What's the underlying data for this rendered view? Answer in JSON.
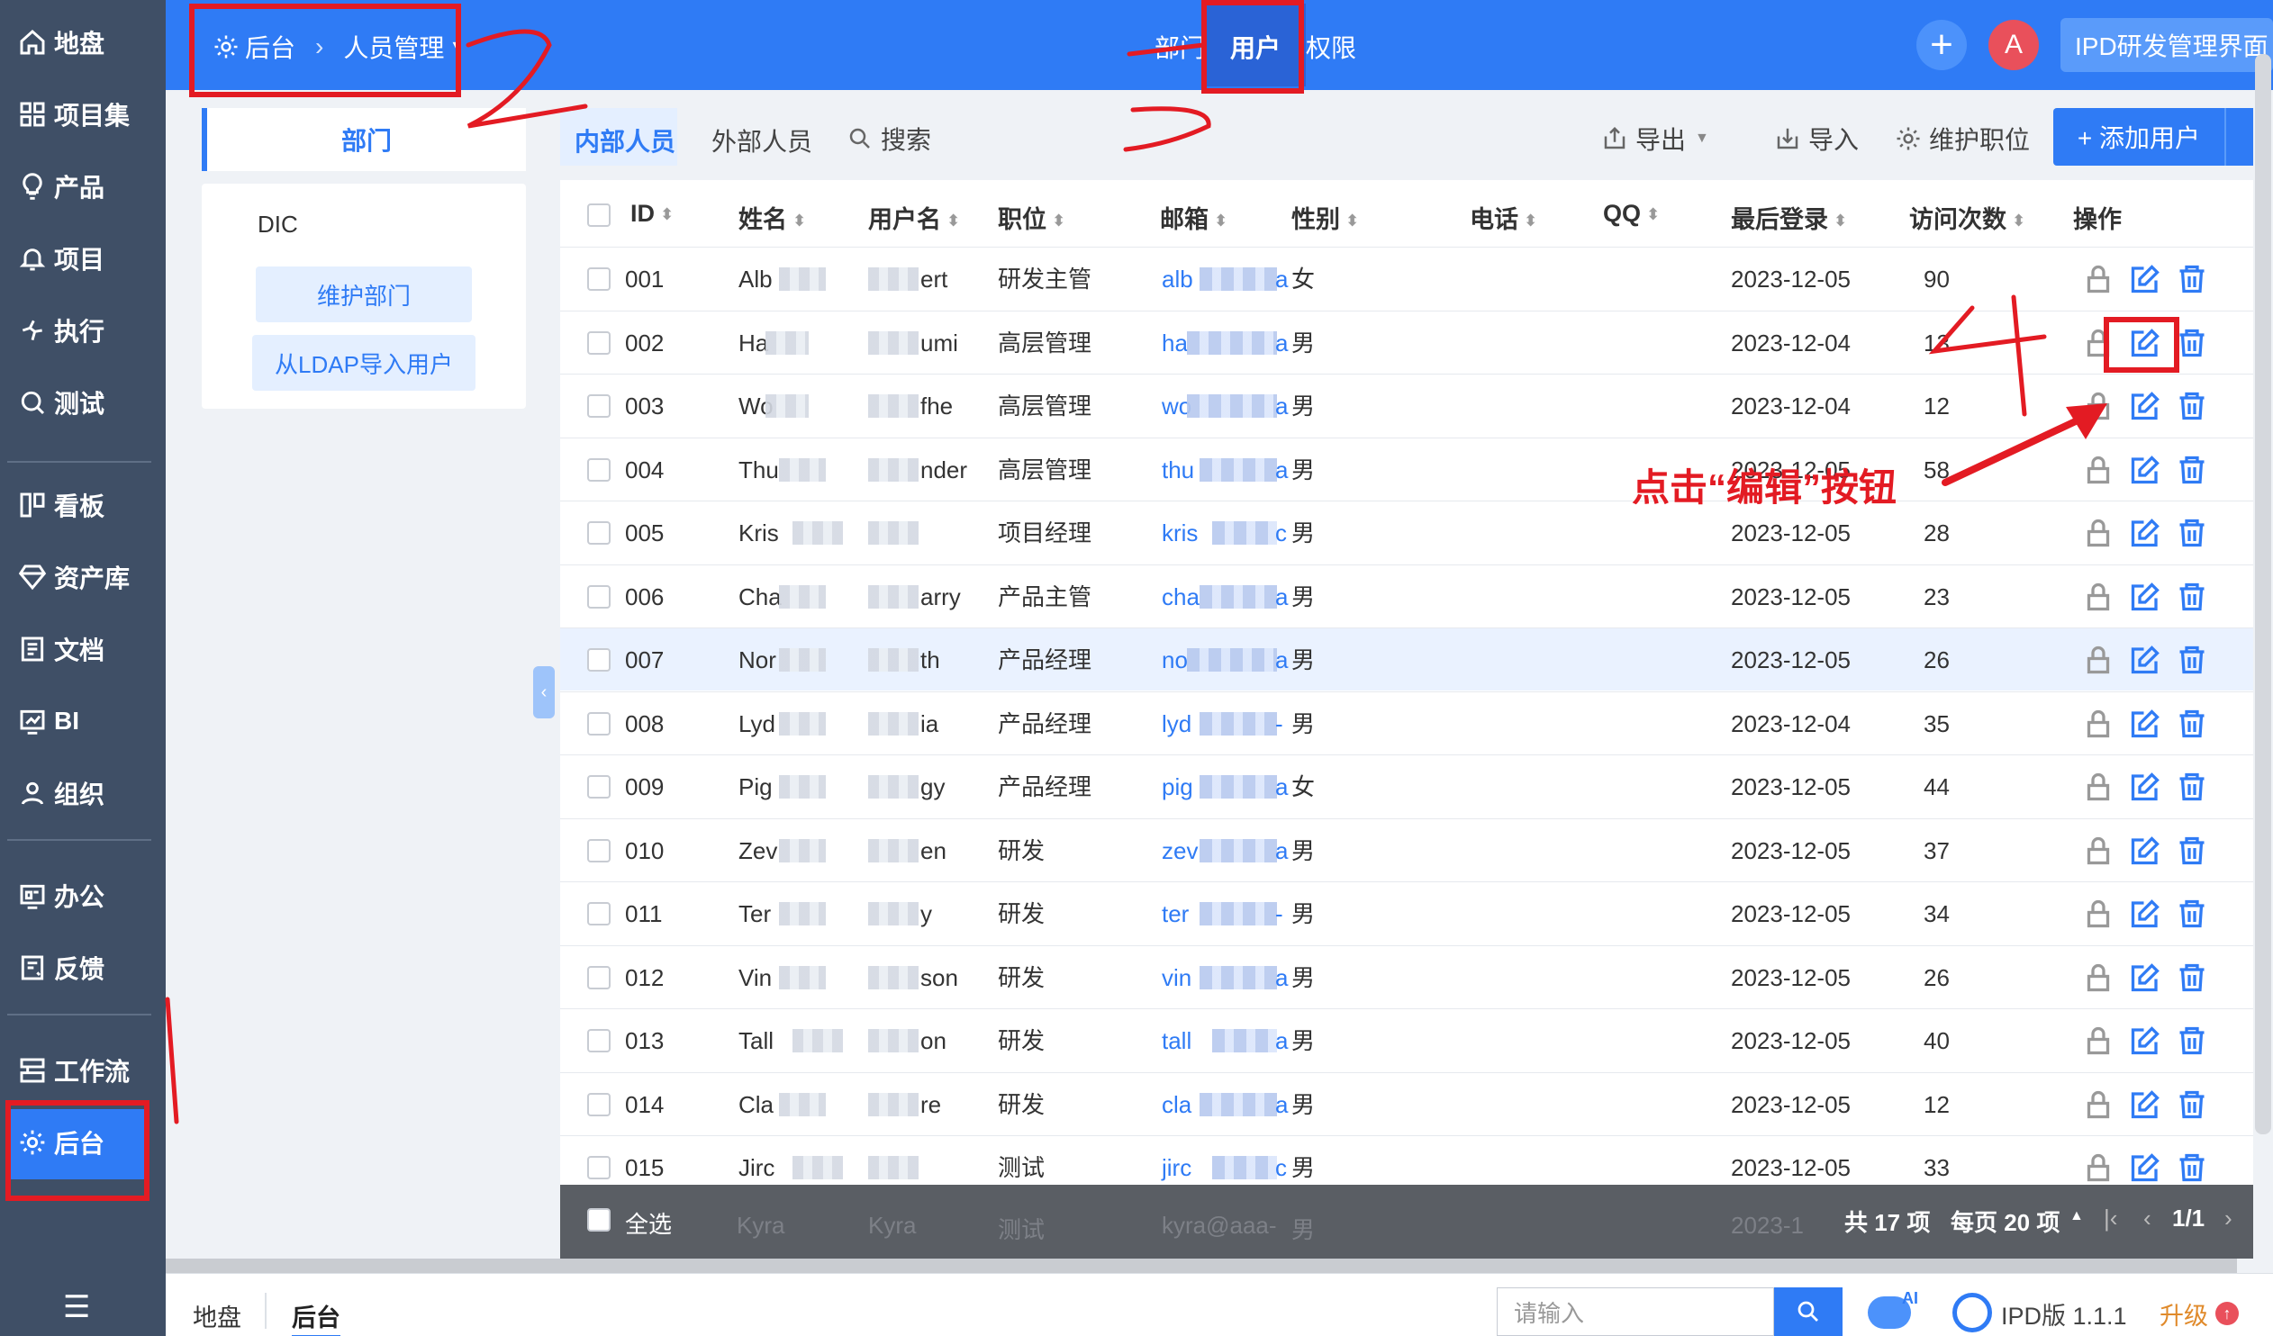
{
  "nav": {
    "items": [
      {
        "label": "地盘",
        "icon": "home-icon"
      },
      {
        "label": "项目集",
        "icon": "grid-icon"
      },
      {
        "label": "产品",
        "icon": "bulb-icon"
      },
      {
        "label": "项目",
        "icon": "bell-icon"
      },
      {
        "label": "执行",
        "icon": "run-icon"
      },
      {
        "label": "测试",
        "icon": "search-icon"
      },
      {
        "label": "看板",
        "icon": "kanban-icon"
      },
      {
        "label": "资产库",
        "icon": "diamond-icon"
      },
      {
        "label": "文档",
        "icon": "doc-icon"
      },
      {
        "label": "BI",
        "icon": "chart-icon"
      },
      {
        "label": "组织",
        "icon": "user-icon"
      },
      {
        "label": "办公",
        "icon": "oa-icon"
      },
      {
        "label": "反馈",
        "icon": "feedback-icon"
      },
      {
        "label": "工作流",
        "icon": "workflow-icon"
      },
      {
        "label": "后台",
        "icon": "gear-icon"
      }
    ],
    "collapse_icon": "menu-collapse-icon"
  },
  "header": {
    "breadcrumb_root": "后台",
    "breadcrumb_current": "人员管理",
    "tabs": [
      "部门",
      "用户",
      "权限"
    ],
    "avatar_letter": "A",
    "workspace": "IPD研发管理界面"
  },
  "dept_panel": {
    "tab_label": "部门",
    "dept_name": "DIC",
    "maintain_btn": "维护部门",
    "ldap_btn": "从LDAP导入用户"
  },
  "toolbar": {
    "internal": "内部人员",
    "external": "外部人员",
    "search": "搜索",
    "export": "导出",
    "import": "导入",
    "maintain_position": "维护职位",
    "add_user": "+ 添加用户"
  },
  "table": {
    "columns": [
      "ID",
      "姓名",
      "用户名",
      "职位",
      "邮箱",
      "性别",
      "电话",
      "QQ",
      "最后登录",
      "访问次数",
      "操作"
    ],
    "rows": [
      {
        "id": "001",
        "name": "Alb",
        "user": "ert",
        "pos": "研发主管",
        "mail": "alb",
        "mail_end": "a",
        "sex": "女",
        "last": "2023-12-05",
        "visits": "90"
      },
      {
        "id": "002",
        "name": "Ha",
        "user": "umi",
        "pos": "高层管理",
        "mail": "ha",
        "mail_end": "a",
        "sex": "男",
        "last": "2023-12-04",
        "visits": "13"
      },
      {
        "id": "003",
        "name": "Wo",
        "user": "fhe",
        "pos": "高层管理",
        "mail": "wo",
        "mail_end": "a",
        "sex": "男",
        "last": "2023-12-04",
        "visits": "12"
      },
      {
        "id": "004",
        "name": "Thu",
        "user": "nder",
        "pos": "高层管理",
        "mail": "thu",
        "mail_end": "a",
        "sex": "男",
        "last": "2023-12-05",
        "visits": "58"
      },
      {
        "id": "005",
        "name": "Kris",
        "user": "",
        "pos": "项目经理",
        "mail": "kris",
        "mail_end": "c",
        "sex": "男",
        "last": "2023-12-05",
        "visits": "28"
      },
      {
        "id": "006",
        "name": "Cha",
        "user": "arry",
        "pos": "产品主管",
        "mail": "cha",
        "mail_end": "a",
        "sex": "男",
        "last": "2023-12-05",
        "visits": "23"
      },
      {
        "id": "007",
        "name": "Nor",
        "user": "th",
        "pos": "产品经理",
        "mail": "no",
        "mail_end": "a",
        "sex": "男",
        "last": "2023-12-05",
        "visits": "26"
      },
      {
        "id": "008",
        "name": "Lyd",
        "user": "ia",
        "pos": "产品经理",
        "mail": "lyd",
        "mail_end": "-",
        "sex": "男",
        "last": "2023-12-04",
        "visits": "35"
      },
      {
        "id": "009",
        "name": "Pig",
        "user": "gy",
        "pos": "产品经理",
        "mail": "pig",
        "mail_end": "a",
        "sex": "女",
        "last": "2023-12-05",
        "visits": "44"
      },
      {
        "id": "010",
        "name": "Zev",
        "user": "en",
        "pos": "研发",
        "mail": "zev",
        "mail_end": "a",
        "sex": "男",
        "last": "2023-12-05",
        "visits": "37"
      },
      {
        "id": "011",
        "name": "Ter",
        "user": "y",
        "pos": "研发",
        "mail": "ter",
        "mail_end": "-",
        "sex": "男",
        "last": "2023-12-05",
        "visits": "34"
      },
      {
        "id": "012",
        "name": "Vin",
        "user": "son",
        "pos": "研发",
        "mail": "vin",
        "mail_end": "a",
        "sex": "男",
        "last": "2023-12-05",
        "visits": "26"
      },
      {
        "id": "013",
        "name": "Tall",
        "user": "on",
        "pos": "研发",
        "mail": "tall",
        "mail_end": "a",
        "sex": "男",
        "last": "2023-12-05",
        "visits": "40"
      },
      {
        "id": "014",
        "name": "Cla",
        "user": "re",
        "pos": "研发",
        "mail": "cla",
        "mail_end": "a",
        "sex": "男",
        "last": "2023-12-05",
        "visits": "12"
      },
      {
        "id": "015",
        "name": "Jirc",
        "user": "",
        "pos": "测试",
        "mail": "jirc",
        "mail_end": "c",
        "sex": "男",
        "last": "2023-12-05",
        "visits": "33"
      }
    ],
    "ghost_row": {
      "name": "Kyra",
      "user": "Kyra",
      "pos": "测试",
      "mail": "kyra@aaa-",
      "sex": "男",
      "last": "2023-1"
    }
  },
  "footer": {
    "select_all": "全选",
    "total": "共 17 项",
    "per_page": "每页 20 项",
    "page": "1/1"
  },
  "bottom": {
    "tab_home": "地盘",
    "tab_admin": "后台",
    "search_placeholder": "请输入",
    "ai_badge": "AI",
    "version": "IPD版 1.1.1",
    "upgrade": "升级"
  },
  "annotations": {
    "callout": "点击“编辑”按钮"
  },
  "colors": {
    "primary": "#2f7bf5",
    "sidebar": "#3f4f66",
    "annotation": "#e31b23"
  }
}
